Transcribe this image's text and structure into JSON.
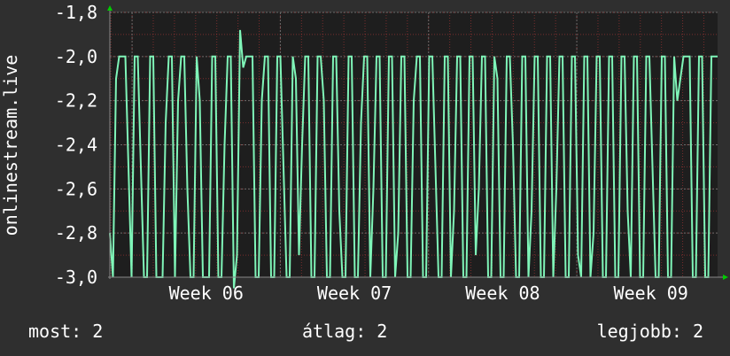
{
  "chart_data": {
    "type": "line",
    "ylabel": "onlinestream.live",
    "ylim": [
      -3.0,
      -1.8
    ],
    "yticks": [
      "-1,8",
      "-2,0",
      "-2,2",
      "-2,4",
      "-2,6",
      "-2,8",
      "-3,0"
    ],
    "ytick_values": [
      -1.8,
      -2.0,
      -2.2,
      -2.4,
      -2.6,
      -2.8,
      -3.0
    ],
    "xticks": [
      "Week 06",
      "Week 07",
      "Week 08",
      "Week 09"
    ],
    "xtick_positions_week": [
      6,
      7,
      8,
      9
    ],
    "xlim_week": [
      5.85,
      9.95
    ],
    "grid": true,
    "series": [
      {
        "color": "#7ff5b8",
        "values": [
          -2.8,
          -3.0,
          -2.1,
          -2.0,
          -2.0,
          -2.0,
          -2.5,
          -3.0,
          -2.0,
          -2.0,
          -2.5,
          -3.0,
          -3.0,
          -2.0,
          -2.0,
          -3.0,
          -3.0,
          -3.0,
          -2.3,
          -2.0,
          -2.0,
          -3.0,
          -2.2,
          -2.0,
          -2.0,
          -2.6,
          -3.0,
          -3.0,
          -2.0,
          -2.2,
          -3.0,
          -3.0,
          -3.0,
          -2.0,
          -2.0,
          -3.0,
          -3.0,
          -2.4,
          -2.0,
          -2.0,
          -3.05,
          -2.9,
          -1.88,
          -2.05,
          -2.0,
          -2.0,
          -2.0,
          -3.0,
          -3.0,
          -2.2,
          -2.0,
          -2.0,
          -3.0,
          -3.0,
          -2.0,
          -2.0,
          -2.5,
          -3.0,
          -3.0,
          -2.0,
          -2.1,
          -2.9,
          -2.4,
          -2.0,
          -2.0,
          -3.0,
          -3.0,
          -2.0,
          -2.0,
          -2.2,
          -3.0,
          -3.0,
          -2.0,
          -2.0,
          -2.7,
          -3.0,
          -3.0,
          -2.0,
          -2.0,
          -3.0,
          -3.0,
          -2.3,
          -2.0,
          -2.0,
          -3.0,
          -2.6,
          -2.0,
          -2.0,
          -3.0,
          -3.0,
          -2.0,
          -2.0,
          -3.0,
          -2.8,
          -2.0,
          -2.0,
          -3.0,
          -3.0,
          -2.2,
          -2.0,
          -2.0,
          -3.0,
          -3.0,
          -2.0,
          -2.0,
          -2.5,
          -3.0,
          -3.0,
          -2.0,
          -2.0,
          -3.0,
          -2.7,
          -2.0,
          -2.0,
          -3.0,
          -3.0,
          -2.0,
          -2.0,
          -2.9,
          -2.6,
          -2.0,
          -2.0,
          -3.0,
          -3.0,
          -2.0,
          -2.1,
          -3.0,
          -3.0,
          -2.0,
          -2.0,
          -2.4,
          -3.0,
          -3.0,
          -2.0,
          -2.0,
          -3.0,
          -2.7,
          -2.0,
          -2.0,
          -3.0,
          -3.0,
          -2.0,
          -2.0,
          -3.0,
          -2.6,
          -2.0,
          -2.0,
          -3.0,
          -3.0,
          -2.0,
          -2.0,
          -2.9,
          -3.0,
          -2.0,
          -2.0,
          -3.0,
          -2.8,
          -2.0,
          -2.0,
          -3.0,
          -3.0,
          -2.0,
          -2.0,
          -3.0,
          -3.0,
          -2.0,
          -2.0,
          -2.7,
          -3.0,
          -2.0,
          -2.0,
          -3.0,
          -3.0,
          -2.0,
          -2.0,
          -2.5,
          -3.0,
          -3.0,
          -2.0,
          -2.0,
          -3.0,
          -3.0,
          -2.0,
          -2.2,
          -2.1,
          -2.0,
          -2.0,
          -2.0,
          -3.0,
          -3.0,
          -2.0,
          -2.0,
          -3.0,
          -3.0,
          -2.0,
          -2.0,
          -2.0
        ],
        "x_start_week": 5.85,
        "x_end_week": 9.95
      }
    ]
  },
  "stats": {
    "now": "most: 2",
    "avg": "átlag: 2",
    "max": "legjobb: 2"
  },
  "colors": {
    "background": "#2f2f2f",
    "plot_area": "#1e1e1e",
    "grid_major": "#6a6a6a",
    "grid_minor": "#c23a3a",
    "line": "#7ff5b8",
    "text": "#ffffff",
    "axis_arrow": "#00cc00"
  }
}
